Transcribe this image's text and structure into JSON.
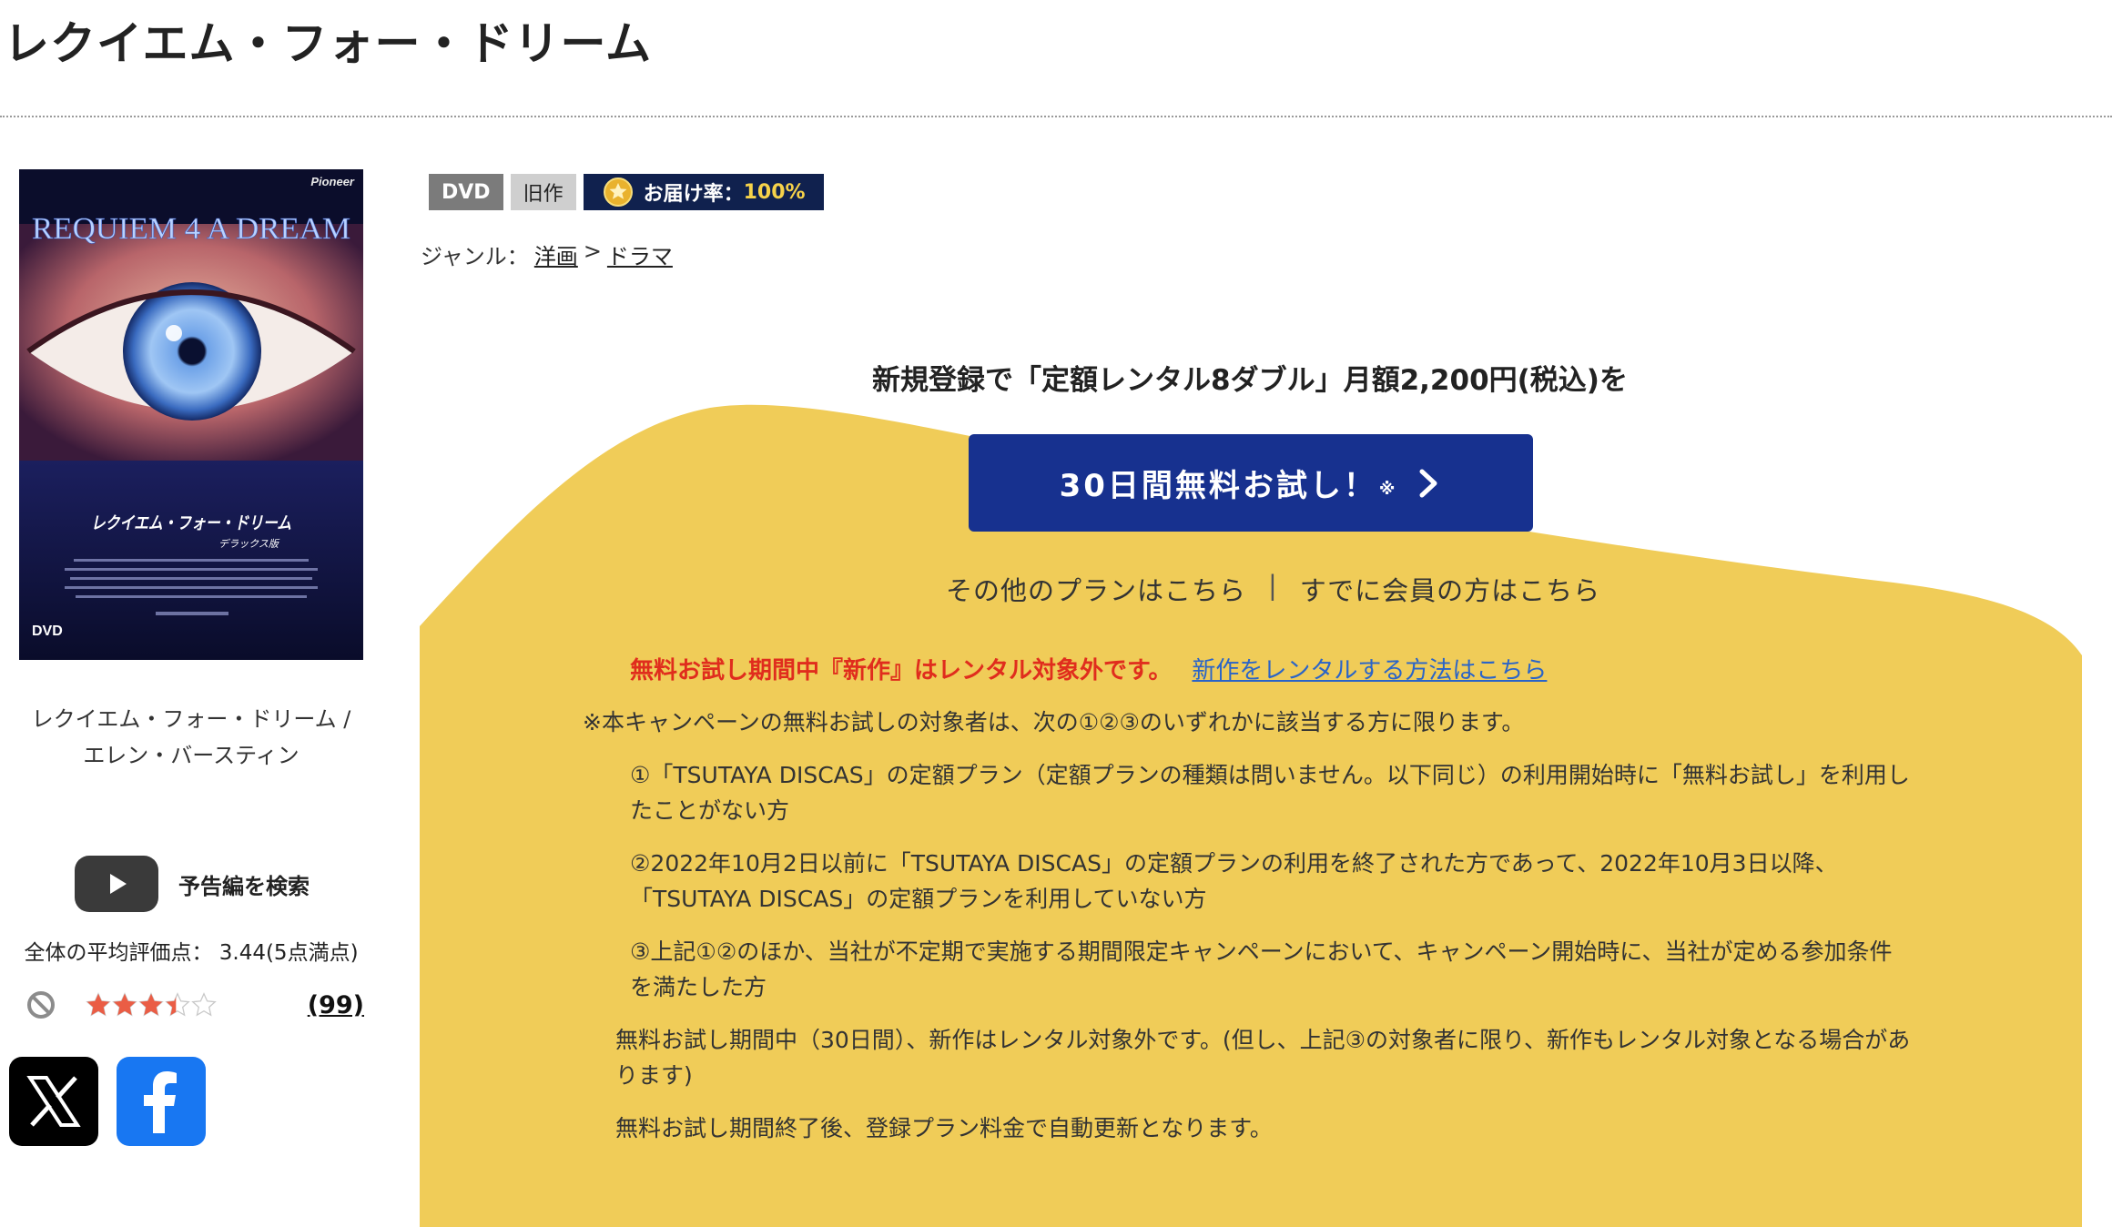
{
  "page": {
    "title": "レクイエム・フォー・ドリーム"
  },
  "product": {
    "poster": {
      "brand": "Pioneer",
      "title_art": "REQUIEM 4 A DREAM",
      "jp_title": "レクイエム・フォー・ドリーム",
      "edition": "デラックス版",
      "format_mark": "DVD"
    },
    "caption_line1": "レクイエム・フォー・ドリーム /",
    "caption_line2": "エレン・バースティン",
    "trailer_label": "予告編を検索",
    "rating_text": "全体の平均評価点： 3.44(5点満点)",
    "rating_value": 3.44,
    "rating_max": 5,
    "review_count": "(99)"
  },
  "badges": {
    "format": "DVD",
    "category": "旧作",
    "delivery_label": "お届け率：",
    "delivery_value": "100%"
  },
  "genre": {
    "label": "ジャンル：",
    "items": [
      "洋画",
      "ドラマ"
    ],
    "separator": ">"
  },
  "promo": {
    "headline": "新規登録で「定額レンタル8ダブル」月額2,200円(税込)を",
    "cta_label": "30日間無料お試し！",
    "cta_note_mark": "※",
    "other_plans": "その他のプランはこちら",
    "divider": "|",
    "member_login": "すでに会員の方はこちら",
    "notice_warning": "無料お試し期間中『新作』はレンタル対象外です。",
    "notice_link": "新作をレンタルする方法はこちら",
    "terms_lead": "※本キャンペーンの無料お試しの対象者は、次の①②③のいずれかに該当する方に限ります。",
    "conditions": [
      "①「TSUTAYA DISCAS」の定額プラン（定額プランの種類は問いません。以下同じ）の利用開始時に「無料お試し」を利用したことがない方",
      "②2022年10月2日以前に「TSUTAYA DISCAS」の定額プランの利用を終了された方であって、2022年10月3日以降、「TSUTAYA DISCAS」の定額プランを利用していない方",
      "③上記①②のほか、当社が不定期で実施する期間限定キャンペーンにおいて、キャンペーン開始時に、当社が定める参加条件を満たした方"
    ],
    "trial_note": "無料お試し期間中（30日間）、新作はレンタル対象外です。(但し、上記③の対象者に限り、新作もレンタル対象となる場合があります)",
    "renewal_note": "無料お試し期間終了後、登録プラン料金で自動更新となります。"
  },
  "colors": {
    "promo_yellow": "#f0cc58",
    "cta_blue": "#17318f",
    "badge_navy": "#10214e",
    "warning_red": "#e02d1d",
    "link_blue": "#2a64c8",
    "star_fill": "#ea5d45"
  },
  "icons": {
    "trailer": "youtube-play-icon",
    "no_rating": "prohibited-icon",
    "delivery": "gold-medal-icon",
    "cta_arrow": "chevron-right-icon",
    "share_x": "x-logo-icon",
    "share_facebook": "facebook-logo-icon"
  }
}
